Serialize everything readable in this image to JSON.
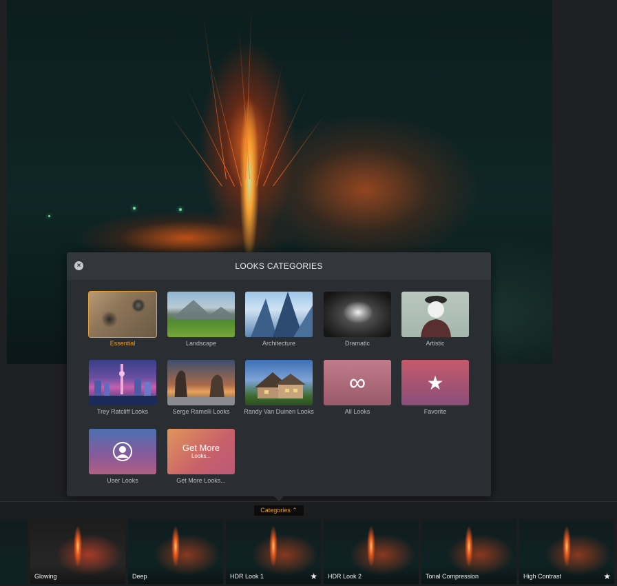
{
  "modal": {
    "title": "LOOKS CATEGORIES",
    "close_label": "×",
    "tiles": [
      {
        "label": "Essential"
      },
      {
        "label": "Landscape"
      },
      {
        "label": "Architecture"
      },
      {
        "label": "Dramatic"
      },
      {
        "label": "Artistic"
      },
      {
        "label": "Trey Ratcliff Looks"
      },
      {
        "label": "Serge Ramelli Looks"
      },
      {
        "label": "Randy Van Duinen Looks"
      },
      {
        "label": "All Looks",
        "icon": "infinity-icon",
        "glyph": "∞"
      },
      {
        "label": "Favorite",
        "icon": "star-icon",
        "glyph": "★"
      },
      {
        "label": "User Looks",
        "icon": "user-icon"
      },
      {
        "label": "Get More Looks...",
        "main": "Get More",
        "sub": "Looks..."
      }
    ]
  },
  "bottom_bar": {
    "categories_label": "Categories ⌃",
    "looks": [
      {
        "label": ""
      },
      {
        "label": "Glowing"
      },
      {
        "label": "Deep"
      },
      {
        "label": "HDR Look 1",
        "favorite": true
      },
      {
        "label": "HDR Look 2"
      },
      {
        "label": "Tonal Compression"
      },
      {
        "label": "High Contrast",
        "favorite": true
      }
    ],
    "star_glyph": "★"
  },
  "colors": {
    "accent": "#e8a12e",
    "panel": "#2a2d32",
    "header": "#33363b"
  }
}
